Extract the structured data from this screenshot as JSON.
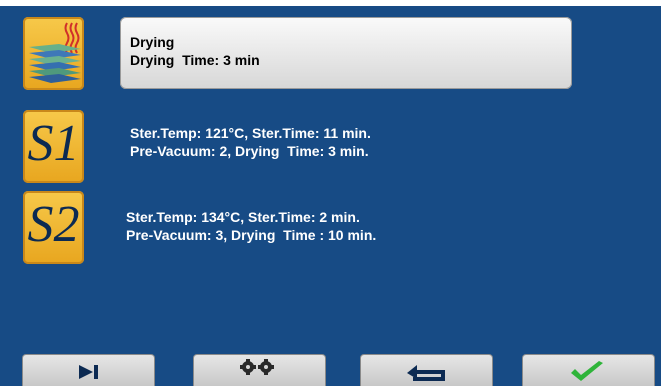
{
  "programs": [
    {
      "icon": "drying-icon",
      "title": "Drying",
      "line": "Drying  Time: 3 min"
    },
    {
      "icon": "s1-program-icon",
      "letter": "S1",
      "line1": "Ster.Temp: 121°C, Ster.Time: 11 min.",
      "line2": "Pre-Vacuum: 2, Drying  Time: 3 min."
    },
    {
      "icon": "s2-program-icon",
      "letter": "S2",
      "line1": "Ster.Temp: 134°C, Ster.Time: 2 min.",
      "line2": "Pre-Vacuum: 3, Drying  Time : 10 min."
    }
  ],
  "bottom_bar": [
    {
      "icon": "skip-forward-icon"
    },
    {
      "icon": "settings-gears-icon"
    },
    {
      "icon": "return-arrow-icon"
    },
    {
      "icon": "checkmark-icon"
    }
  ],
  "colors": {
    "background": "#174b85",
    "panel": "#e6e6e6",
    "accent": "#f0b22e",
    "check": "#2fb43a"
  }
}
